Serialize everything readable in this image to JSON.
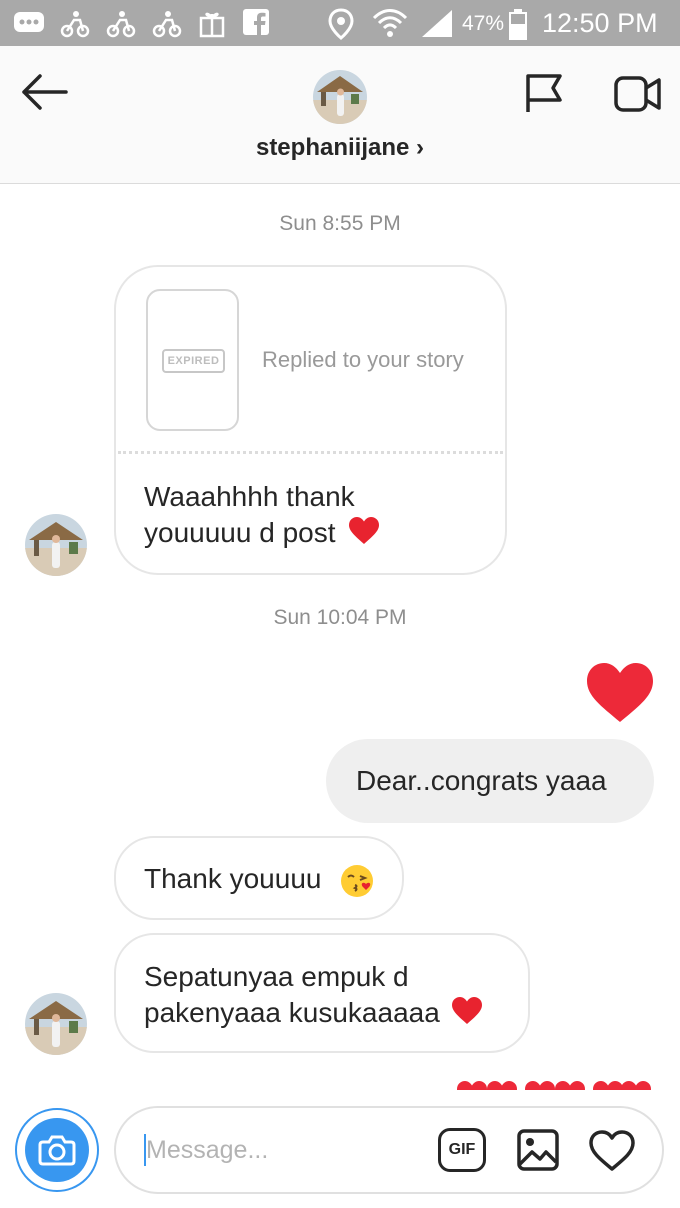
{
  "status_bar": {
    "battery_percent": "47%",
    "time": "12:50 PM"
  },
  "header": {
    "username": "stephaniijane",
    "chevron": "›"
  },
  "conversation": {
    "timestamp_1": "Sun 8:55 PM",
    "story_reply": {
      "expired_label": "EXPIRED",
      "replied_text": "Replied to your story",
      "message_line1": "Waaahhhh thank",
      "message_line2": "youuuuu d post"
    },
    "timestamp_2": "Sun 10:04 PM",
    "my_message": "Dear..congrats yaaa",
    "their_message_1": "Thank youuuu",
    "their_message_2_line1": "Sepatunyaa empuk d",
    "their_message_2_line2": "pakenyaaa kusukaaaaa"
  },
  "composer": {
    "placeholder": "Message...",
    "gif_label": "GIF"
  },
  "colors": {
    "accent_blue": "#3897f0",
    "heart_red": "#ed4956",
    "status_bar": "#a9a9a9"
  },
  "icons": [
    "back-arrow-icon",
    "flag-icon",
    "video-camera-icon",
    "camera-icon",
    "gif-icon",
    "image-icon",
    "heart-outline-icon",
    "heart-emoji-icon",
    "kiss-emoji-icon"
  ]
}
